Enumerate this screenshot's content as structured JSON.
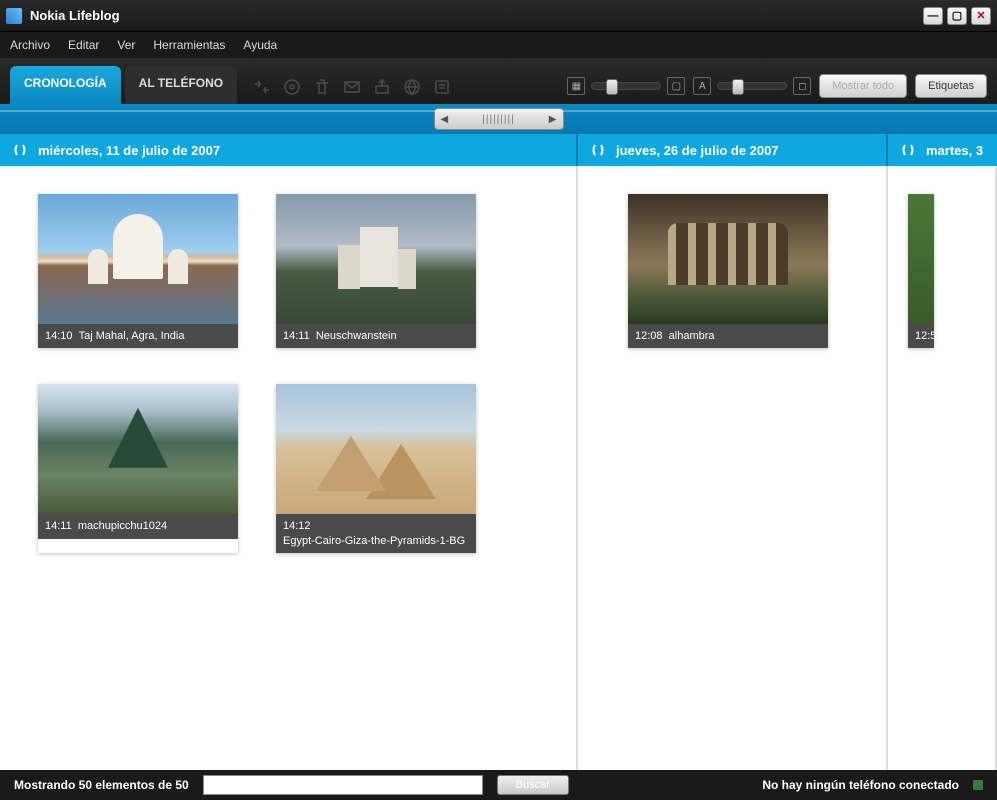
{
  "window": {
    "title": "Nokia Lifeblog"
  },
  "menu": {
    "archivo": "Archivo",
    "editar": "Editar",
    "ver": "Ver",
    "herramientas": "Herramientas",
    "ayuda": "Ayuda"
  },
  "tabs": {
    "cronologia": "CRONOLOGÍA",
    "al_telefono": "AL TELÉFONO"
  },
  "toolbar_buttons": {
    "mostrar_todo": "Mostrar todo",
    "etiquetas": "Etiquetas"
  },
  "dates": {
    "d1": "miércoles, 11 de julio de 2007",
    "d2": "jueves, 26 de julio de 2007",
    "d3": "martes, 3"
  },
  "items": {
    "taj": {
      "time": "14:10",
      "title": "Taj Mahal, Agra, India"
    },
    "castle": {
      "time": "14:11",
      "title": "Neuschwanstein"
    },
    "machu": {
      "time": "14:11",
      "title": "machupicchu1024"
    },
    "pyramid": {
      "time": "14:12",
      "title": "Egypt-Cairo-Giza-the-Pyramids-1-BG"
    },
    "alhambra": {
      "time": "12:08",
      "title": "alhambra"
    },
    "partial": {
      "time": "12:5"
    }
  },
  "status": {
    "count": "Mostrando 50 elementos de 50",
    "buscar": "Buscar",
    "phone": "No hay ningún teléfono conectado"
  }
}
